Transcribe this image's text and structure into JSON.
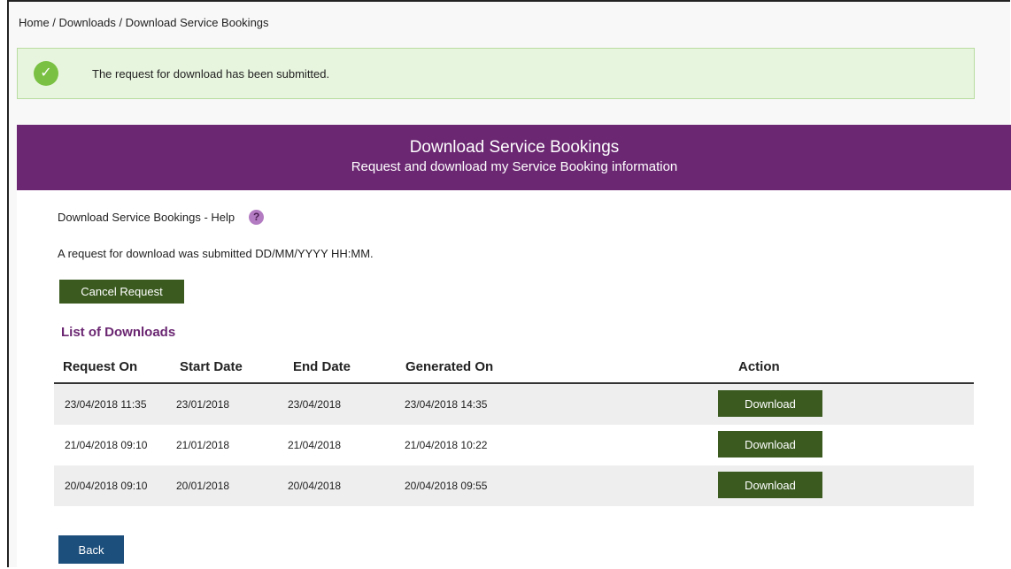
{
  "breadcrumb": "Home / Downloads / Download Service Bookings",
  "alert": {
    "icon": "check-circle-icon",
    "message": "The request for download has been submitted."
  },
  "banner": {
    "title": "Download Service Bookings",
    "subtitle": "Request and download my Service Booking information"
  },
  "help": {
    "label": "Download Service Bookings - Help",
    "icon": "?"
  },
  "submitted_text": "A request for download was submitted DD/MM/YYYY HH:MM.",
  "cancel_label": "Cancel Request",
  "list_title": "List of Downloads",
  "table": {
    "headers": [
      "Request On",
      "Start Date",
      "End Date",
      "Generated On",
      "Action"
    ],
    "rows": [
      {
        "request_on": "23/04/2018 11:35",
        "start": "23/01/2018",
        "end": "23/04/2018",
        "generated": "23/04/2018 14:35",
        "action": "Download"
      },
      {
        "request_on": "21/04/2018 09:10",
        "start": "21/01/2018",
        "end": "21/04/2018",
        "generated": "21/04/2018 10:22",
        "action": "Download"
      },
      {
        "request_on": "20/04/2018 09:10",
        "start": "20/01/2018",
        "end": "20/04/2018",
        "generated": "20/04/2018 09:55",
        "action": "Download"
      }
    ]
  },
  "back_label": "Back",
  "colors": {
    "banner": "#6b2772",
    "success": "#7ac143",
    "button_green": "#3a5a1f",
    "button_blue": "#1d4f7c"
  }
}
